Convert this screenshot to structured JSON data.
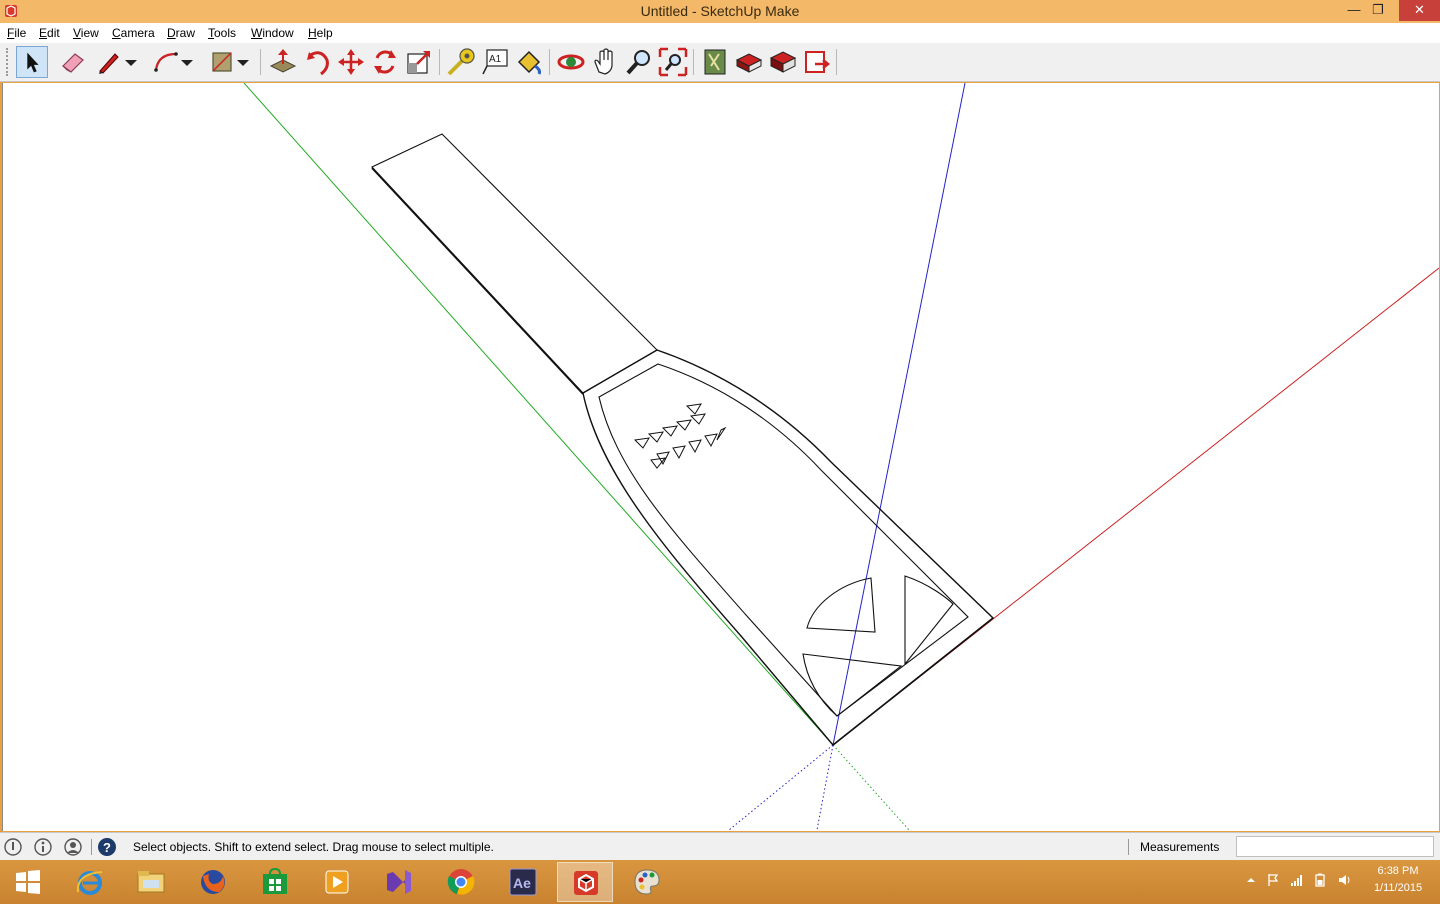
{
  "window": {
    "title": "Untitled - SketchUp Make",
    "minimize": "—",
    "restore": "❐",
    "close": "✕"
  },
  "menu": [
    "File",
    "Edit",
    "View",
    "Camera",
    "Draw",
    "Tools",
    "Window",
    "Help"
  ],
  "toolbar": {
    "tools": [
      "select",
      "eraser",
      "pencil",
      "arc",
      "rectangle",
      "push-pull",
      "follow-me",
      "move",
      "rotate",
      "scale",
      "tape-measure",
      "text",
      "paint-bucket",
      "orbit",
      "pan",
      "zoom",
      "zoom-extents",
      "3d-warehouse",
      "share-model",
      "get-models",
      "send-to-layout"
    ],
    "active_tool": "select",
    "text_tool_glyph": "A1"
  },
  "status": {
    "message": "Select objects. Shift to extend select. Drag mouse to select multiple.",
    "measurements_label": "Measurements",
    "measurements_value": "",
    "help_glyph": "?"
  },
  "taskbar": {
    "apps": [
      "windows-start",
      "internet-explorer",
      "file-explorer",
      "firefox",
      "windows-store",
      "media-player",
      "visual-studio",
      "chrome",
      "after-effects",
      "sketchup",
      "paint"
    ],
    "active_app": "sketchup",
    "after_effects_glyph": "Ae"
  },
  "clock": {
    "time": "6:38 PM",
    "date": "1/11/2015"
  },
  "colors": {
    "title_bar": "#f4b869",
    "taskbar": "#d08a36",
    "axis_red": "#cc2222",
    "axis_green": "#22aa22",
    "axis_blue": "#2222cc",
    "close_button": "#c7403a"
  }
}
